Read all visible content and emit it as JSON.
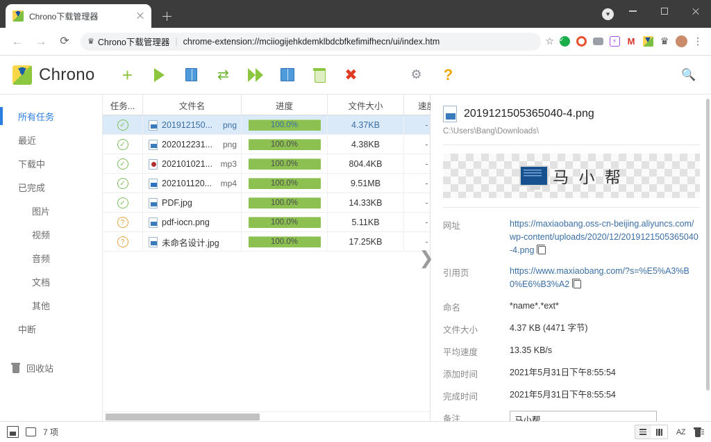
{
  "browser": {
    "tab": {
      "title": "Chrono下载管理器",
      "favicon": "chrono-icon",
      "close": "×"
    },
    "newtab_label": "+",
    "nav": {
      "back": "←",
      "forward": "→",
      "reload": "⟳"
    },
    "omnibox": {
      "extension_chip": "Chrono下载管理器",
      "separator": "|",
      "url": "chrome-extension://mciiogijehkdemklbdcbfkefimifhecn/ui/index.htm",
      "star": "☆"
    },
    "extension_icons": [
      "green-check-icon",
      "orange-ring-icon",
      "gray-extension-icon",
      "violet-flash-icon",
      "gmail-icon",
      "chrono-extension-icon",
      "puzzle-icon",
      "profile-avatar",
      "chrome-menu-icon"
    ],
    "window_controls": {
      "heart": "♥",
      "minimize": "—",
      "maximize": "□",
      "close": "×"
    }
  },
  "app": {
    "brand": "Chrono",
    "toolbar": [
      {
        "name": "add-task-button",
        "label": "新建任务"
      },
      {
        "name": "start-button",
        "label": "开始"
      },
      {
        "name": "pause-button",
        "label": "暂停"
      },
      {
        "name": "retry-button",
        "label": "重试"
      },
      {
        "name": "start-all-button",
        "label": "全部开始"
      },
      {
        "name": "pause-all-button",
        "label": "全部暂停"
      },
      {
        "name": "clear-button",
        "label": "清除"
      },
      {
        "name": "remove-button",
        "label": "删除"
      },
      {
        "name": "settings-button",
        "label": "设置"
      },
      {
        "name": "help-button",
        "label": "帮助"
      }
    ],
    "search_icon": "search-icon"
  },
  "sidebar": {
    "items": [
      {
        "label": "所有任务",
        "active": true,
        "sub": false
      },
      {
        "label": "最近",
        "active": false,
        "sub": false
      },
      {
        "label": "下载中",
        "active": false,
        "sub": false
      },
      {
        "label": "已完成",
        "active": false,
        "sub": false
      },
      {
        "label": "图片",
        "active": false,
        "sub": true
      },
      {
        "label": "视频",
        "active": false,
        "sub": true
      },
      {
        "label": "音频",
        "active": false,
        "sub": true
      },
      {
        "label": "文档",
        "active": false,
        "sub": true
      },
      {
        "label": "其他",
        "active": false,
        "sub": true
      },
      {
        "label": "中断",
        "active": false,
        "sub": false
      }
    ],
    "recycle": {
      "label": "回收站",
      "icon": "trash-icon"
    }
  },
  "table": {
    "columns": [
      "任务...",
      "文件名",
      "进度",
      "文件大小",
      "速度"
    ],
    "rows": [
      {
        "status": "done",
        "name": "201912150...",
        "ext": "png",
        "progress": "100.0%",
        "size": "4.37KB",
        "speed": "-",
        "icon": "image-file-icon",
        "selected": true
      },
      {
        "status": "done",
        "name": "202012231...",
        "ext": "png",
        "progress": "100.0%",
        "size": "4.38KB",
        "speed": "-",
        "icon": "image-file-icon",
        "selected": false
      },
      {
        "status": "done",
        "name": "202101021...",
        "ext": "mp3",
        "progress": "100.0%",
        "size": "804.4KB",
        "speed": "-",
        "icon": "audio-file-icon",
        "selected": false
      },
      {
        "status": "done",
        "name": "202101120...",
        "ext": "mp4",
        "progress": "100.0%",
        "size": "9.51MB",
        "speed": "-",
        "icon": "video-file-icon",
        "selected": false
      },
      {
        "status": "done",
        "name": "PDF.jpg",
        "ext": "",
        "progress": "100.0%",
        "size": "14.33KB",
        "speed": "-",
        "icon": "image-file-icon",
        "selected": false
      },
      {
        "status": "unknown",
        "name": "pdf-iocn.png",
        "ext": "",
        "progress": "100.0%",
        "size": "5.11KB",
        "speed": "-",
        "icon": "image-file-icon",
        "selected": false
      },
      {
        "status": "unknown",
        "name": "未命名设计.jpg",
        "ext": "",
        "progress": "100.0%",
        "size": "17.25KB",
        "speed": "-",
        "icon": "image-file-icon",
        "selected": false
      }
    ],
    "status_glyph_done": "✓",
    "status_glyph_unknown": "?",
    "collapse_handle": "❯"
  },
  "detail": {
    "filename": "2019121505365040-4.png",
    "path": "C:\\Users\\Bang\\Downloads\\",
    "preview_text": "马 小 帮",
    "fields": [
      {
        "label": "网址",
        "value": "https://maxiaobang.oss-cn-beijing.aliyuncs.com/wp-content/uploads/2020/12/2019121505365040-4.png",
        "link": true,
        "copy": true
      },
      {
        "label": "引用页",
        "value": "https://www.maxiaobang.com/?s=%E5%A3%B0%E6%B3%A2",
        "link": true,
        "copy": true
      },
      {
        "label": "命名",
        "value": "*name*.*ext*",
        "link": false,
        "copy": false
      },
      {
        "label": "文件大小",
        "value": "4.37 KB (4471 字节)",
        "link": false,
        "copy": false
      },
      {
        "label": "平均速度",
        "value": "13.35 KB/s",
        "link": false,
        "copy": false
      },
      {
        "label": "添加时间",
        "value": "2021年5月31日下午8:55:54",
        "link": false,
        "copy": false
      },
      {
        "label": "完成时间",
        "value": "2021年5月31日下午8:55:54",
        "link": false,
        "copy": false
      }
    ],
    "note": {
      "label": "备注",
      "value": "马小帮",
      "placeholder": ""
    }
  },
  "statusbar": {
    "capture_icon": "capture-icon",
    "folder_icon": "folder-icon",
    "count": "7 项",
    "view_list": "list-view-icon",
    "view_grid": "grid-view-icon",
    "sort_label": "AZ",
    "clear_icon": "clear-trash-icon"
  },
  "colors": {
    "accent": "#2b7de0",
    "progress": "#8cc152",
    "selected_row": "#dbeaf8",
    "titlebar": "#3c3c3c",
    "link": "#3a6ea5"
  }
}
